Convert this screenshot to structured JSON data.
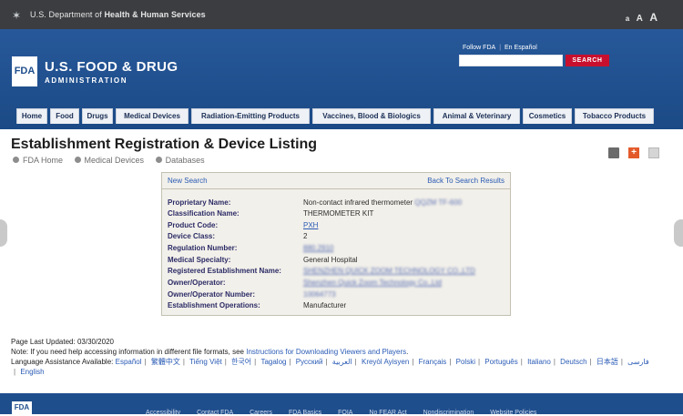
{
  "topbar": {
    "hhs_prefix": "U.S. Department of ",
    "hhs_bold": "Health & Human Services",
    "textsize": [
      "a",
      "A",
      "A"
    ]
  },
  "header": {
    "logo": "FDA",
    "brand_line1": "U.S. FOOD & DRUG",
    "brand_line2": "ADMINISTRATION",
    "links": [
      "Follow FDA",
      "En Español"
    ],
    "search_placeholder": "",
    "search_button": "SEARCH"
  },
  "tabs": [
    "Home",
    "Food",
    "Drugs",
    "Medical Devices",
    "Radiation-Emitting Products",
    "Vaccines, Blood & Biologics",
    "Animal & Veterinary",
    "Cosmetics",
    "Tobacco Products"
  ],
  "page": {
    "title": "Establishment Registration & Device Listing",
    "breadcrumbs": [
      "FDA Home",
      "Medical Devices",
      "Databases"
    ]
  },
  "panel": {
    "new_search": "New Search",
    "back": "Back To Search Results",
    "rows": [
      {
        "label": "Proprietary Name:",
        "value": "Non-contact infrared thermometer",
        "extra": "QQZM TF-600"
      },
      {
        "label": "Classification Name:",
        "value": "THERMOMETER KIT"
      },
      {
        "label": "Product Code:",
        "value": "PXH"
      },
      {
        "label": "Device Class:",
        "value": "2"
      },
      {
        "label": "Regulation Number:",
        "value": "880.2910"
      },
      {
        "label": "Medical Specialty:",
        "value": "General Hospital"
      },
      {
        "label": "Registered Establishment Name:",
        "value": "SHENZHEN QUICK ZOOM TECHNOLOGY CO.,LTD"
      },
      {
        "label": "Owner/Operator:",
        "value": "Shenzhen Quick Zoom Technology Co.,Ltd"
      },
      {
        "label": "Owner/Operator Number:",
        "value": "10064773"
      },
      {
        "label": "Establishment Operations:",
        "value": "Manufacturer"
      }
    ]
  },
  "footer": {
    "last_updated": "Page Last Updated: 03/30/2020",
    "note_prefix": "Note: If you need help accessing information in different file formats, see ",
    "note_link": "Instructions for Downloading Viewers and Players",
    "note_suffix": ".",
    "lang_prefix": "Language Assistance Available: ",
    "languages": [
      "Español",
      "繁體中文",
      "Tiếng Việt",
      "한국어",
      "Tagalog",
      "Русский",
      "العربية",
      "Kreyòl Ayisyen",
      "Français",
      "Polski",
      "Português",
      "Italiano",
      "Deutsch",
      "日本語",
      "فارسی",
      "English"
    ],
    "logo": "FDA",
    "links": [
      "Accessibility",
      "Contact FDA",
      "Careers",
      "FDA Basics",
      "FOIA",
      "No FEAR Act",
      "Nondiscrimination",
      "Website Policies"
    ]
  },
  "colors": {
    "header_blue": "#1f4e8c",
    "link_blue": "#2a5bb5",
    "search_red": "#c8102e",
    "panel_bg": "#f2f0ea"
  }
}
